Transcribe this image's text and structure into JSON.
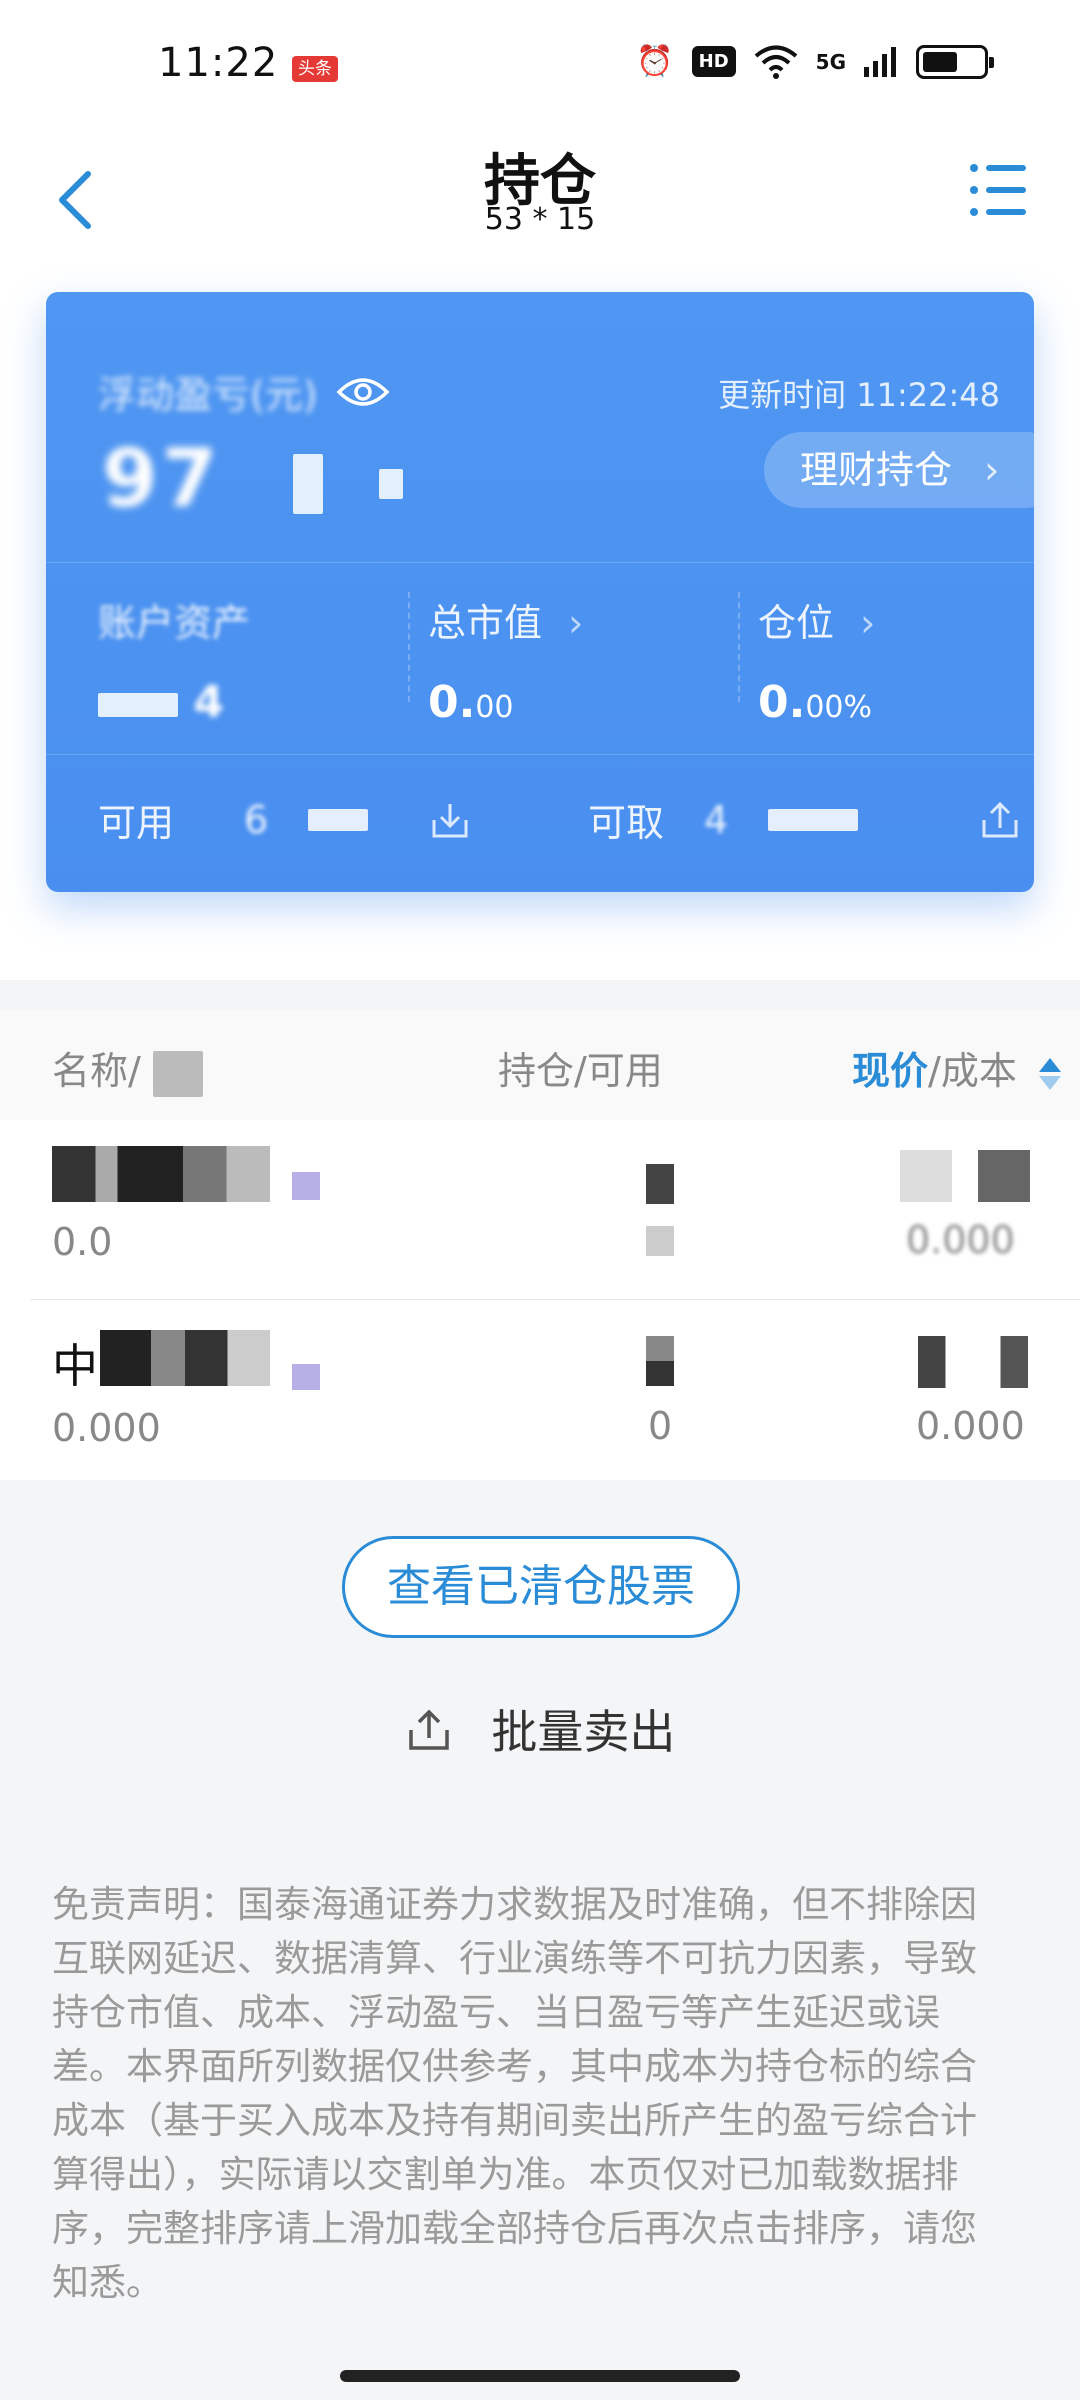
{
  "status_bar": {
    "time": "11:22",
    "news_badge": "头条",
    "hd": "HD",
    "network": "5G"
  },
  "nav": {
    "title": "持仓",
    "subtitle": "53 * 15"
  },
  "summary": {
    "pl_label": "浮动盈亏(元)",
    "update_label": "更新时间 11:22:48",
    "pl_value": "97",
    "wealth_button": "理财持仓",
    "asset_label": "账户资产",
    "asset_value": "4",
    "market_value_label": "总市值",
    "market_value_int": "0.",
    "market_value_dec": "00",
    "position_label": "仓位",
    "position_int": "0.",
    "position_dec": "00%",
    "available_label": "可用",
    "available_value": "6",
    "withdrawable_label": "可取",
    "withdrawable_value": "4"
  },
  "list_header": {
    "name_col": "名称/",
    "position_col": "持仓/可用",
    "price_col_accent": "现价",
    "price_col_rest": "/成本"
  },
  "rows": [
    {
      "name": "",
      "sub": "0.0",
      "position": "",
      "available": "",
      "price": "",
      "cost": "0.000"
    },
    {
      "name": "中",
      "sub": "0.000",
      "position": "",
      "available": "0",
      "price": "",
      "cost": "0.000"
    }
  ],
  "actions": {
    "cleared_button": "查看已清仓股票",
    "batch_sell": "批量卖出"
  },
  "disclaimer": "免责声明：国泰海通证券力求数据及时准确，但不排除因互联网延迟、数据清算、行业演练等不可抗力因素，导致持仓市值、成本、浮动盈亏、当日盈亏等产生延迟或误差。本界面所列数据仅供参考，其中成本为持仓标的综合成本（基于买入成本及持有期间卖出所产生的盈亏综合计算得出），实际请以交割单为准。本页仅对已加载数据排序，完整排序请上滑加载全部持仓后再次点击排序，请您知悉。",
  "colors": {
    "card_blue": "#4a8ff0",
    "accent": "#2a8bd6",
    "badge_red": "#e53935"
  }
}
